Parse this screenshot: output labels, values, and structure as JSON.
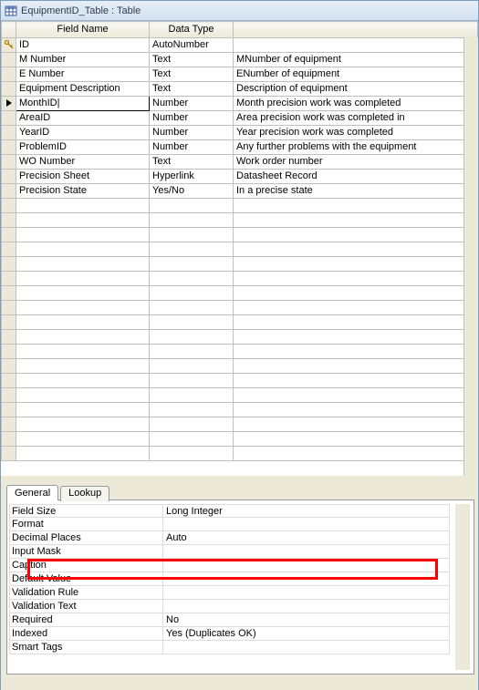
{
  "window": {
    "title": "EquipmentID_Table : Table"
  },
  "grid": {
    "headers": {
      "field": "Field Name",
      "type": "Data Type",
      "desc": ""
    },
    "rows": [
      {
        "marker": "key",
        "field": "ID",
        "type": "AutoNumber",
        "desc": ""
      },
      {
        "marker": "",
        "field": "M Number",
        "type": "Text",
        "desc": "MNumber of equipment"
      },
      {
        "marker": "",
        "field": "E Number",
        "type": "Text",
        "desc": "ENumber of equipment"
      },
      {
        "marker": "",
        "field": "Equipment Description",
        "type": "Text",
        "desc": "Description of equipment"
      },
      {
        "marker": "cur",
        "field": "MonthID",
        "type": "Number",
        "desc": "Month precision work was completed",
        "editing": true
      },
      {
        "marker": "",
        "field": "AreaID",
        "type": "Number",
        "desc": "Area precision work was completed in"
      },
      {
        "marker": "",
        "field": "YearID",
        "type": "Number",
        "desc": "Year precision work was completed"
      },
      {
        "marker": "",
        "field": "ProblemID",
        "type": "Number",
        "desc": "Any further problems with the equipment"
      },
      {
        "marker": "",
        "field": "WO Number",
        "type": "Text",
        "desc": "Work order number"
      },
      {
        "marker": "",
        "field": "Precision Sheet",
        "type": "Hyperlink",
        "desc": "Datasheet Record"
      },
      {
        "marker": "",
        "field": "Precision State",
        "type": "Yes/No",
        "desc": "In a precise state"
      }
    ],
    "empty_rows": 18
  },
  "tabs": {
    "general": "General",
    "lookup": "Lookup"
  },
  "props": [
    {
      "label": "Field Size",
      "value": "Long Integer"
    },
    {
      "label": "Format",
      "value": ""
    },
    {
      "label": "Decimal Places",
      "value": "Auto"
    },
    {
      "label": "Input Mask",
      "value": ""
    },
    {
      "label": "Caption",
      "value": ""
    },
    {
      "label": "Default Value",
      "value": ""
    },
    {
      "label": "Validation Rule",
      "value": ""
    },
    {
      "label": "Validation Text",
      "value": ""
    },
    {
      "label": "Required",
      "value": "No"
    },
    {
      "label": "Indexed",
      "value": "Yes (Duplicates OK)"
    },
    {
      "label": "Smart Tags",
      "value": ""
    }
  ]
}
